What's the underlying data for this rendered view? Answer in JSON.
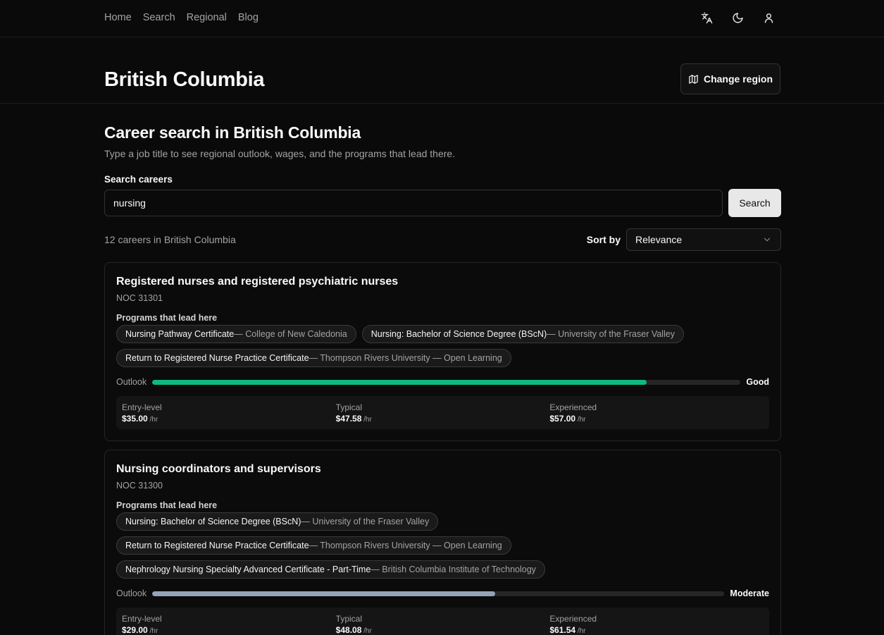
{
  "nav": {
    "links": [
      "Home",
      "Search",
      "Regional",
      "Blog"
    ]
  },
  "icons": {
    "translate": "translate-icon",
    "theme": "moon-icon",
    "user": "user-icon",
    "map": "map-icon",
    "chevron": "chevron-down-icon"
  },
  "region": {
    "title": "British Columbia",
    "change_label": "Change region"
  },
  "search": {
    "title": "Career search in British Columbia",
    "subtitle": "Type a job title to see regional outlook, wages, and the programs that lead there.",
    "label": "Search careers",
    "value": "nursing",
    "button": "Search"
  },
  "results": {
    "count_text": "12 careers in British Columbia",
    "sort_label": "Sort by",
    "sort_value": "Relevance"
  },
  "cards": [
    {
      "title": "Registered nurses and registered psychiatric nurses",
      "noc": "NOC 31301",
      "programs_label": "Programs that lead here",
      "programs": [
        {
          "name": "Nursing Pathway Certificate",
          "inst": " — College of New Caledonia"
        },
        {
          "name": "Nursing: Bachelor of Science Degree (BScN)",
          "inst": " — University of the Fraser Valley"
        },
        {
          "name": "Return to Registered Nurse Practice Certificate",
          "inst": " — Thompson Rivers University — Open Learning"
        }
      ],
      "outlook_label": "Outlook",
      "outlook_value": "Good",
      "outlook_level": 0.84,
      "outlook_color": "#10b981",
      "wages": [
        {
          "label": "Entry-level",
          "value": "$35.00",
          "unit": " /hr"
        },
        {
          "label": "Typical",
          "value": "$47.58",
          "unit": " /hr"
        },
        {
          "label": "Experienced",
          "value": "$57.00",
          "unit": " /hr"
        }
      ]
    },
    {
      "title": "Nursing coordinators and supervisors",
      "noc": "NOC 31300",
      "programs_label": "Programs that lead here",
      "programs": [
        {
          "name": "Nursing: Bachelor of Science Degree (BScN)",
          "inst": " — University of the Fraser Valley"
        },
        {
          "name": "Return to Registered Nurse Practice Certificate",
          "inst": " — Thompson Rivers University — Open Learning"
        },
        {
          "name": "Nephrology Nursing Specialty Advanced Certificate - Part-Time",
          "inst": " — British Columbia Institute of Technology"
        }
      ],
      "outlook_label": "Outlook",
      "outlook_value": "Moderate",
      "outlook_level": 0.6,
      "outlook_color": "#94a3b8",
      "wages": [
        {
          "label": "Entry-level",
          "value": "$29.00",
          "unit": " /hr"
        },
        {
          "label": "Typical",
          "value": "$48.08",
          "unit": " /hr"
        },
        {
          "label": "Experienced",
          "value": "$61.54",
          "unit": " /hr"
        }
      ]
    }
  ]
}
